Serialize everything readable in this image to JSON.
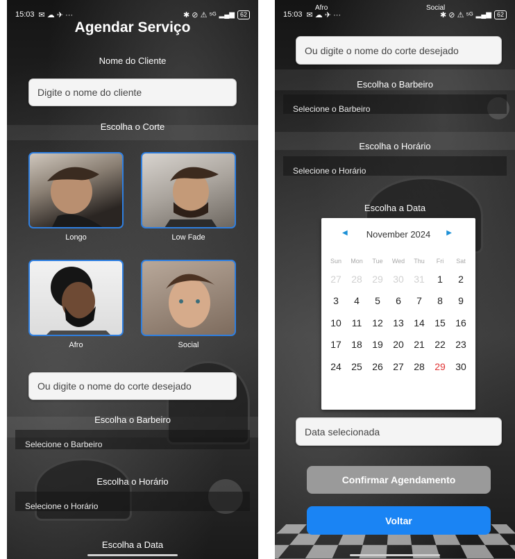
{
  "status": {
    "time": "15:03",
    "left_icons": "✉ ☁ ✈ ···",
    "right_icons": "✱ ⊘ ⚠ ⁵ᴳ",
    "battery": "62"
  },
  "left": {
    "title": "Agendar Serviço",
    "client_label": "Nome do Cliente",
    "client_placeholder": "Digite o nome do cliente",
    "cut_label": "Escolha o Corte",
    "cuts": [
      {
        "name": "Longo",
        "icon": "long-hair-photo"
      },
      {
        "name": "Low Fade",
        "icon": "low-fade-photo"
      },
      {
        "name": "Afro",
        "icon": "afro-photo"
      },
      {
        "name": "Social",
        "icon": "social-photo"
      }
    ],
    "cut_input_placeholder": "Ou digite o nome do corte desejado",
    "barber_label": "Escolha o Barbeiro",
    "barber_select": "Selecione o Barbeiro",
    "time_label": "Escolha o Horário",
    "time_select": "Selecione o Horário",
    "date_label": "Escolha a Data"
  },
  "right": {
    "status_overlay_left": "Afro",
    "status_overlay_right": "Social",
    "cut_input_placeholder": "Ou digite o nome do corte desejado",
    "barber_label": "Escolha o Barbeiro",
    "barber_select": "Selecione o Barbeiro",
    "time_label": "Escolha o Horário",
    "time_select": "Selecione o Horário",
    "date_label": "Escolha a Data",
    "calendar": {
      "month": "November 2024",
      "weekdays": [
        "Sun",
        "Mon",
        "Tue",
        "Wed",
        "Thu",
        "Fri",
        "Sat"
      ],
      "weeks": [
        [
          "27",
          "28",
          "29",
          "30",
          "31",
          "1",
          "2"
        ],
        [
          "3",
          "4",
          "5",
          "6",
          "7",
          "8",
          "9"
        ],
        [
          "10",
          "11",
          "12",
          "13",
          "14",
          "15",
          "16"
        ],
        [
          "17",
          "18",
          "19",
          "20",
          "21",
          "22",
          "23"
        ],
        [
          "24",
          "25",
          "26",
          "27",
          "28",
          "29",
          "30"
        ]
      ],
      "muted_first_row": 5,
      "today": "29"
    },
    "date_placeholder": "Data selecionada",
    "confirm_button": "Confirmar Agendamento",
    "back_button": "Voltar"
  },
  "colors": {
    "accent_blue": "#1a84f4",
    "card_border": "#2f7fe0",
    "confirm_gray": "#9a9a9a",
    "today_red": "#e03434"
  }
}
